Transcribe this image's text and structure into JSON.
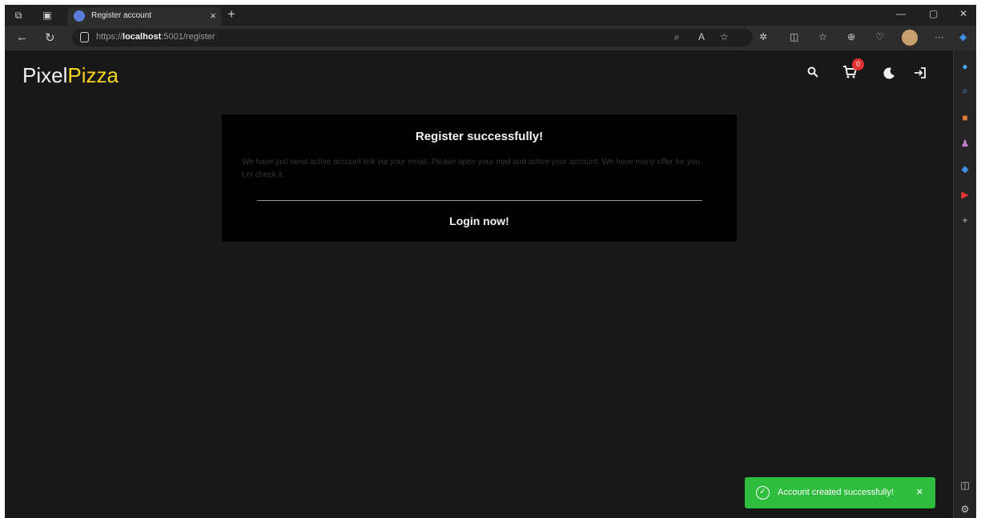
{
  "browser": {
    "tab_title": "Register account",
    "tab_close": "×",
    "new_tab": "+",
    "minimize": "—",
    "restore": "▢",
    "close": "✕",
    "back": "←",
    "refresh": "↻",
    "url_prefix": "https://",
    "url_host": "localhost",
    "url_rest": ":5001/register",
    "more": "···"
  },
  "header": {
    "logo_part1": "Pixel",
    "logo_part2": "Pizza",
    "cart_count": "0"
  },
  "card": {
    "heading": "Register successfully!",
    "message": "We have just send active account link via your email. Please open your mail and active your account. We have many offer for you. Let check it.",
    "login_label": "Login now!"
  },
  "toast": {
    "text": "Account created successfully!",
    "close": "×"
  },
  "colors": {
    "accent": "#f5d31a",
    "toast_bg": "#2fbd3d",
    "badge": "#e03030",
    "page_bg": "#181818",
    "card_bg": "#000000"
  },
  "icons": {
    "header": [
      "search-icon",
      "cart-icon",
      "moon-icon",
      "login-icon"
    ],
    "toolbar": [
      "read-aloud-icon",
      "favorite-icon",
      "extensions-icon",
      "split-screen-icon",
      "favorites-icon",
      "collections-icon",
      "performance-icon"
    ],
    "rail": [
      "bell-icon",
      "search-icon",
      "briefcase-icon",
      "people-icon",
      "copilot-icon",
      "youtube-icon",
      "add-icon",
      "sidebar-icon",
      "settings-icon"
    ]
  }
}
